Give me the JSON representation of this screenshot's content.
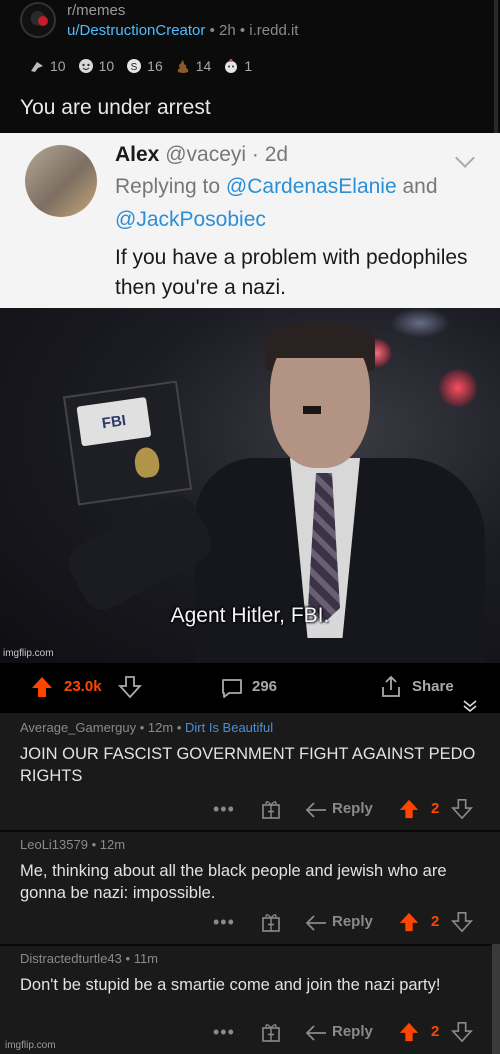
{
  "post": {
    "subreddit": "r/memes",
    "author": "u/DestructionCreator",
    "age": "2h",
    "domain": "i.redd.it",
    "awards": [
      {
        "icon": "rocket-like-award",
        "count": "10"
      },
      {
        "icon": "face-award",
        "count": "10"
      },
      {
        "icon": "coin-award",
        "count": "16"
      },
      {
        "icon": "poop-award",
        "count": "14"
      },
      {
        "icon": "silver-award",
        "count": "1"
      }
    ],
    "title": "You are under arrest"
  },
  "meme": {
    "tweet": {
      "name": "Alex",
      "handle": "@vaceyi",
      "age": "· 2d",
      "replying_prefix": "Replying to",
      "mention1": "@CardenasElanie",
      "and_word": "and",
      "mention2": "@JackPosobiec",
      "text": "If you have a problem with pedophiles then you're a nazi."
    },
    "badge_text": "FBI",
    "caption": "Agent Hitler, FBI.",
    "watermark": "imgflip.com"
  },
  "actions": {
    "upvotes": "23.0k",
    "comments": "296",
    "share_label": "Share",
    "accent": "#ff4500"
  },
  "comments": [
    {
      "author": "Average_Gamerguy",
      "age": "12m",
      "flair": "Dirt Is Beautiful",
      "body": "JOIN OUR FASCIST GOVERNMENT FIGHT AGAINST PEDO RIGHTS",
      "reply_label": "Reply",
      "score": "2"
    },
    {
      "author": "LeoLi13579",
      "age": "12m",
      "flair": "",
      "body": "Me, thinking about all the black people and jewish who are gonna be nazi: impossible.",
      "reply_label": "Reply",
      "score": "2"
    },
    {
      "author": "Distractedturtle43",
      "age": "11m",
      "flair": "",
      "body": "Don't be stupid be a smartie come and join the nazi party!",
      "reply_label": "Reply",
      "score": "2"
    }
  ],
  "footer_watermark": "imgflip.com"
}
